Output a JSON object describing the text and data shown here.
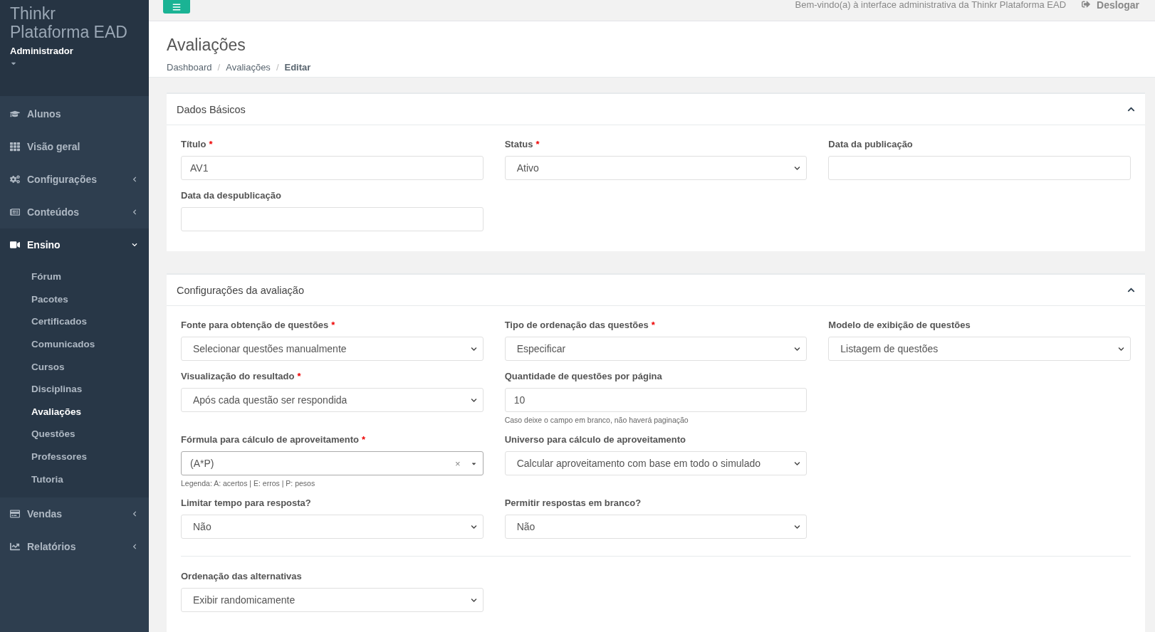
{
  "sidebar": {
    "brand_lines": [
      "Thinkr",
      "Plataforma EAD"
    ],
    "user": "Administrador",
    "items": [
      {
        "label": "Alunos",
        "kind": "link"
      },
      {
        "label": "Visão geral",
        "kind": "link"
      },
      {
        "label": "Configurações",
        "kind": "group",
        "expanded": false
      },
      {
        "label": "Conteúdos",
        "kind": "group",
        "expanded": false
      },
      {
        "label": "Ensino",
        "kind": "group",
        "expanded": true,
        "children": [
          {
            "label": "Fórum",
            "selected": false
          },
          {
            "label": "Pacotes",
            "selected": false
          },
          {
            "label": "Certificados",
            "selected": false
          },
          {
            "label": "Comunicados",
            "selected": false
          },
          {
            "label": "Cursos",
            "selected": false
          },
          {
            "label": "Disciplinas",
            "selected": false
          },
          {
            "label": "Avaliações",
            "selected": true
          },
          {
            "label": "Questões",
            "selected": false
          },
          {
            "label": "Professores",
            "selected": false
          },
          {
            "label": "Tutoria",
            "selected": false
          }
        ]
      },
      {
        "label": "Vendas",
        "kind": "group",
        "expanded": false
      },
      {
        "label": "Relatórios",
        "kind": "group",
        "expanded": false
      }
    ]
  },
  "topbar": {
    "welcome": "Bem-vindo(a) à interface administrativa da Thinkr Plataforma EAD",
    "logout": "Deslogar"
  },
  "header": {
    "title": "Avaliações",
    "separator": "/",
    "breadcrumb": [
      {
        "label": "Dashboard",
        "current": false
      },
      {
        "label": "Avaliações",
        "current": false
      },
      {
        "label": "Editar",
        "current": true
      }
    ]
  },
  "cards": [
    {
      "title": "Dados Básicos",
      "expanded": true,
      "rows": [
        {
          "kind": "fields",
          "fields": [
            {
              "label": "Título",
              "required_mark": "*",
              "kind": "text",
              "value": "AV1"
            },
            {
              "label": "Status",
              "required_mark": "*",
              "kind": "select",
              "value": "Ativo"
            },
            {
              "label": "Data da publicação",
              "kind": "text"
            }
          ]
        },
        {
          "kind": "fields",
          "fields": [
            {
              "label": "Data da despublicação",
              "kind": "text"
            }
          ]
        }
      ]
    },
    {
      "title": "Configurações da avaliação",
      "expanded": true,
      "rows": [
        {
          "kind": "fields",
          "fields": [
            {
              "label": "Fonte para obtenção de questões",
              "required_mark": "*",
              "kind": "select",
              "value": "Selecionar questões manualmente"
            },
            {
              "label": "Tipo de ordenação das questões",
              "required_mark": "*",
              "kind": "select",
              "value": "Especificar"
            },
            {
              "label": "Modelo de exibição de questões",
              "kind": "select",
              "value": "Listagem de questões"
            }
          ]
        },
        {
          "kind": "fields",
          "fields": [
            {
              "label": "Visualização do resultado",
              "required_mark": "*",
              "kind": "select",
              "value": "Após cada questão ser respondida"
            },
            {
              "label": "Quantidade de questões por página",
              "kind": "text",
              "value": "10",
              "hint": "Caso deixe o campo em branco, não haverá paginação"
            }
          ]
        },
        {
          "kind": "fields",
          "fields": [
            {
              "label": "Fórmula para cálculo de aproveitamento",
              "required_mark": "*",
              "kind": "select2",
              "value": "(A*P)",
              "clear": "×",
              "hint": "Legenda: A: acertos | E: erros | P: pesos"
            },
            {
              "label": "Universo para cálculo de aproveitamento",
              "kind": "select",
              "value": "Calcular aproveitamento com base em todo o simulado"
            }
          ]
        },
        {
          "kind": "fields",
          "fields": [
            {
              "label": "Limitar tempo para resposta?",
              "kind": "select",
              "value": "Não"
            },
            {
              "label": "Permitir respostas em branco?",
              "kind": "select",
              "value": "Não"
            }
          ]
        },
        {
          "kind": "divider"
        },
        {
          "kind": "fields",
          "fields": [
            {
              "label": "Ordenação das alternativas",
              "kind": "select",
              "value": "Exibir randomicamente"
            }
          ]
        }
      ]
    }
  ]
}
